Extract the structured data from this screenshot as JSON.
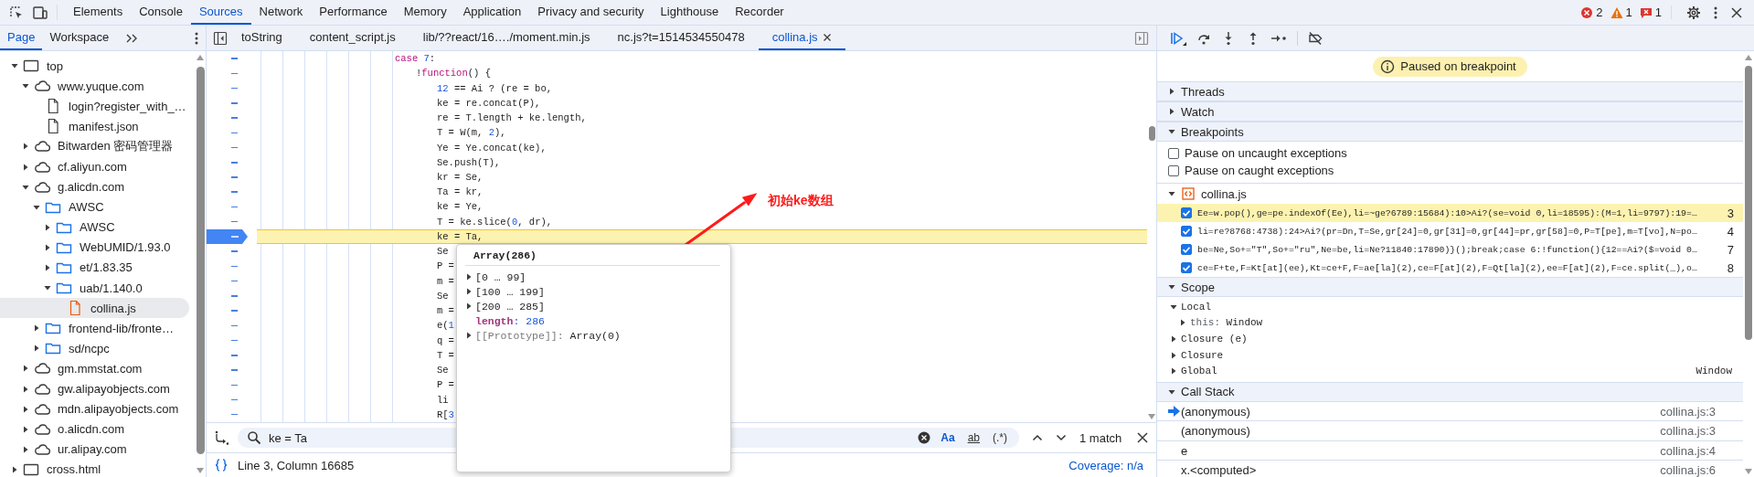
{
  "devtools_tabs": [
    {
      "label": "Elements",
      "selected": false
    },
    {
      "label": "Console",
      "selected": false
    },
    {
      "label": "Sources",
      "selected": true
    },
    {
      "label": "Network",
      "selected": false
    },
    {
      "label": "Performance",
      "selected": false
    },
    {
      "label": "Memory",
      "selected": false
    },
    {
      "label": "Application",
      "selected": false
    },
    {
      "label": "Privacy and security",
      "selected": false
    },
    {
      "label": "Lighthouse",
      "selected": false
    },
    {
      "label": "Recorder",
      "selected": false
    }
  ],
  "counters": [
    {
      "kind": "error",
      "count": "2"
    },
    {
      "kind": "warning",
      "count": "1"
    },
    {
      "kind": "issue",
      "count": "1"
    }
  ],
  "navigator": {
    "tabs": [
      {
        "label": "Page",
        "selected": true
      },
      {
        "label": "Workspace",
        "selected": false
      }
    ],
    "tree": [
      {
        "label": "top",
        "kind": "frame",
        "expanded": true,
        "selected": false,
        "children": [
          {
            "label": "www.yuque.com",
            "kind": "cloud",
            "expanded": true,
            "selected": false,
            "children": [
              {
                "label": "login?register_with_…",
                "kind": "file",
                "selected": false
              },
              {
                "label": "manifest.json",
                "kind": "file",
                "selected": false
              }
            ]
          },
          {
            "label": "Bitwarden 密码管理器",
            "kind": "cloud",
            "expanded": false,
            "selected": false
          },
          {
            "label": "cf.aliyun.com",
            "kind": "cloud",
            "expanded": false,
            "selected": false
          },
          {
            "label": "g.alicdn.com",
            "kind": "cloud",
            "expanded": true,
            "selected": false,
            "children": [
              {
                "label": "AWSC",
                "kind": "folder",
                "expanded": true,
                "selected": false,
                "children": [
                  {
                    "label": "AWSC",
                    "kind": "folder",
                    "expanded": false,
                    "selected": false
                  },
                  {
                    "label": "WebUMID/1.93.0",
                    "kind": "folder",
                    "expanded": false,
                    "selected": false
                  },
                  {
                    "label": "et/1.83.35",
                    "kind": "folder",
                    "expanded": false,
                    "selected": false
                  },
                  {
                    "label": "uab/1.140.0",
                    "kind": "folder",
                    "expanded": true,
                    "selected": false,
                    "children": [
                      {
                        "label": "collina.js",
                        "kind": "script",
                        "selected": true
                      }
                    ]
                  }
                ]
              },
              {
                "label": "frontend-lib/fronte…",
                "kind": "folder",
                "expanded": false,
                "selected": false
              },
              {
                "label": "sd/ncpc",
                "kind": "folder",
                "expanded": false,
                "selected": false
              }
            ]
          },
          {
            "label": "gm.mmstat.com",
            "kind": "cloud",
            "expanded": false,
            "selected": false
          },
          {
            "label": "gw.alipayobjects.com",
            "kind": "cloud",
            "expanded": false,
            "selected": false
          },
          {
            "label": "mdn.alipayobjects.com",
            "kind": "cloud",
            "expanded": false,
            "selected": false
          },
          {
            "label": "o.alicdn.com",
            "kind": "cloud",
            "expanded": false,
            "selected": false
          },
          {
            "label": "ur.alipay.com",
            "kind": "cloud",
            "expanded": false,
            "selected": false
          }
        ]
      },
      {
        "label": "cross.html",
        "kind": "frame",
        "expanded": false,
        "selected": false
      }
    ]
  },
  "editor": {
    "tabs": [
      {
        "label": "toString",
        "selected": false
      },
      {
        "label": "content_script.js",
        "selected": false
      },
      {
        "label": "lib/??react/16…./moment.min.js",
        "selected": false
      },
      {
        "label": "nc.js?t=1514534550478",
        "selected": false
      },
      {
        "label": "collina.js",
        "selected": true
      }
    ],
    "code": [
      {
        "paused": false,
        "segments": [
          {
            "text": "case",
            "kind": "keyword"
          },
          {
            "text": " 7",
            "kind": "number"
          },
          {
            "text": ":",
            "kind": "plain"
          }
        ],
        "children": [
          {
            "paused": false,
            "segments": [
              {
                "text": "!",
                "kind": "plain"
              },
              {
                "text": "function",
                "kind": "keyword"
              },
              {
                "text": "() {",
                "kind": "plain"
              }
            ],
            "children": [
              {
                "paused": false,
                "segments": [
                  {
                    "text": "12",
                    "kind": "number"
                  },
                  {
                    "text": " == Ai ? (re = bo,",
                    "kind": "plain"
                  }
                ]
              },
              {
                "paused": false,
                "segments": [
                  {
                    "text": "ke = re.concat(P),",
                    "kind": "plain"
                  }
                ]
              },
              {
                "paused": false,
                "segments": [
                  {
                    "text": "re = T.length + ke.length,",
                    "kind": "plain"
                  }
                ]
              },
              {
                "paused": false,
                "segments": [
                  {
                    "text": "T = W(m, ",
                    "kind": "plain"
                  },
                  {
                    "text": "2",
                    "kind": "number"
                  },
                  {
                    "text": "),",
                    "kind": "plain"
                  }
                ]
              },
              {
                "paused": false,
                "segments": [
                  {
                    "text": "Ye = Ye.concat(ke),",
                    "kind": "plain"
                  }
                ]
              },
              {
                "paused": false,
                "segments": [
                  {
                    "text": "Se.push(T),",
                    "kind": "plain"
                  }
                ]
              },
              {
                "paused": false,
                "segments": [
                  {
                    "text": "kr = Se,",
                    "kind": "plain"
                  }
                ]
              },
              {
                "paused": false,
                "segments": [
                  {
                    "text": "Ta = kr,",
                    "kind": "plain"
                  }
                ]
              },
              {
                "paused": false,
                "segments": [
                  {
                    "text": "ke = Ye,",
                    "kind": "plain"
                  }
                ]
              },
              {
                "paused": false,
                "segments": [
                  {
                    "text": "T = ke.slice(",
                    "kind": "plain"
                  },
                  {
                    "text": "0",
                    "kind": "number"
                  },
                  {
                    "text": ", dr),",
                    "kind": "plain"
                  }
                ]
              },
              {
                "paused": true,
                "segments": [
                  {
                    "text": "ke = Ta,",
                    "kind": "plain"
                  }
                ]
              },
              {
                "paused": false,
                "segments": [
                  {
                    "text": "Se",
                    "kind": "plain"
                  }
                ]
              },
              {
                "paused": false,
                "segments": [
                  {
                    "text": "P =",
                    "kind": "plain"
                  }
                ]
              },
              {
                "paused": false,
                "segments": [
                  {
                    "text": "m =",
                    "kind": "plain"
                  }
                ]
              },
              {
                "paused": false,
                "segments": [
                  {
                    "text": "Se",
                    "kind": "plain"
                  }
                ]
              },
              {
                "paused": false,
                "segments": [
                  {
                    "text": "m =",
                    "kind": "plain"
                  }
                ]
              },
              {
                "paused": false,
                "segments": [
                  {
                    "text": "e(",
                    "kind": "plain"
                  },
                  {
                    "text": "1",
                    "kind": "number"
                  }
                ]
              },
              {
                "paused": false,
                "segments": [
                  {
                    "text": "q =",
                    "kind": "plain"
                  }
                ]
              },
              {
                "paused": false,
                "segments": [
                  {
                    "text": "T =",
                    "kind": "plain"
                  }
                ]
              },
              {
                "paused": false,
                "segments": [
                  {
                    "text": "Se",
                    "kind": "plain"
                  }
                ]
              },
              {
                "paused": false,
                "segments": [
                  {
                    "text": "P =",
                    "kind": "plain"
                  }
                ]
              },
              {
                "paused": false,
                "segments": [
                  {
                    "text": "li",
                    "kind": "plain"
                  }
                ]
              },
              {
                "paused": false,
                "segments": [
                  {
                    "text": "R[",
                    "kind": "plain"
                  },
                  {
                    "text": "3",
                    "kind": "number"
                  }
                ]
              }
            ]
          }
        ]
      }
    ],
    "popup": {
      "title": "Array(286)",
      "entries": [
        {
          "kind": "range",
          "label": "[0 … 99]",
          "expanded": false
        },
        {
          "kind": "range",
          "label": "[100 … 199]",
          "expanded": false
        },
        {
          "kind": "range",
          "label": "[200 … 285]",
          "expanded": false
        },
        {
          "kind": "property",
          "key": "length",
          "value": ": 286"
        },
        {
          "kind": "prototype",
          "key": "[[Prototype]]: ",
          "value": "Array(0)",
          "expanded": false
        }
      ]
    },
    "annotation": "初始ke数组",
    "search": {
      "value": "ke = Ta",
      "options": [
        {
          "kind": "case",
          "label": "Aa",
          "on": true
        },
        {
          "kind": "word",
          "label": "ab",
          "on": false
        },
        {
          "kind": "regex",
          "label": "(.*)",
          "on": false
        }
      ],
      "result": "1 match"
    },
    "status": {
      "position": "Line 3, Column 16685",
      "coverage": "Coverage: n/a"
    }
  },
  "debugger": {
    "banner": "Paused on breakpoint",
    "sections": [
      {
        "kind": "threads",
        "title": "Threads",
        "expanded": false
      },
      {
        "kind": "watch",
        "title": "Watch",
        "expanded": false
      },
      {
        "kind": "breakpoints",
        "title": "Breakpoints",
        "expanded": true,
        "options": [
          {
            "label": "Pause on uncaught exceptions",
            "checked": false
          },
          {
            "label": "Pause on caught exceptions",
            "checked": false
          }
        ],
        "groups": [
          {
            "file": "collina.js",
            "expanded": true,
            "items": [
              {
                "code": "Ee=w.pop(),ge=pe.indexOf(Ee),li=~ge?6789:15684):10>Ai?(se=void 0,li=18595):(M=1,li=9797):19=…",
                "line": "3",
                "checked": true,
                "selected": true
              },
              {
                "code": "li=re?8768:4738):24>Ai?(pr=Dn,T=Se,gr[24]=0,gr[31]=0,gr[44]=pr,gr[58]=0,P=T[pe],m=T[vo],N=po…",
                "line": "4",
                "checked": true,
                "selected": false
              },
              {
                "code": "be=Ne,So+=\"T\",So+=\"ru\",Ne=be,li=Ne?11840:17890)}();break;case 6:!function(){12==Ai?($=void 0…",
                "line": "7",
                "checked": true,
                "selected": false
              },
              {
                "code": "ce=F+te,F=Kt[at](ee),Kt=ce+F,F=ae[la](2),ce=F[at](2),F=Qt[la](2),ee=F[at](2),F=ce.split(_),o…",
                "line": "8",
                "checked": true,
                "selected": false
              }
            ]
          }
        ]
      },
      {
        "kind": "scope",
        "title": "Scope",
        "expanded": true,
        "items": [
          {
            "name": "Local",
            "expanded": true,
            "children": [
              {
                "name": "this: ",
                "value": "Window",
                "expanded": false
              }
            ]
          },
          {
            "name": "Closure (e)",
            "expanded": false
          },
          {
            "name": "Closure",
            "expanded": false
          },
          {
            "name": "Global",
            "expanded": false,
            "value": "Window"
          }
        ]
      },
      {
        "kind": "callstack",
        "title": "Call Stack",
        "expanded": true,
        "frames": [
          {
            "name": "(anonymous)",
            "location": "collina.js:3",
            "current": true
          },
          {
            "name": "(anonymous)",
            "location": "collina.js:3",
            "current": false
          },
          {
            "name": "e",
            "location": "collina.js:4",
            "current": false
          },
          {
            "name": "x.<computed>",
            "location": "collina.js:6",
            "current": false
          }
        ]
      }
    ]
  }
}
